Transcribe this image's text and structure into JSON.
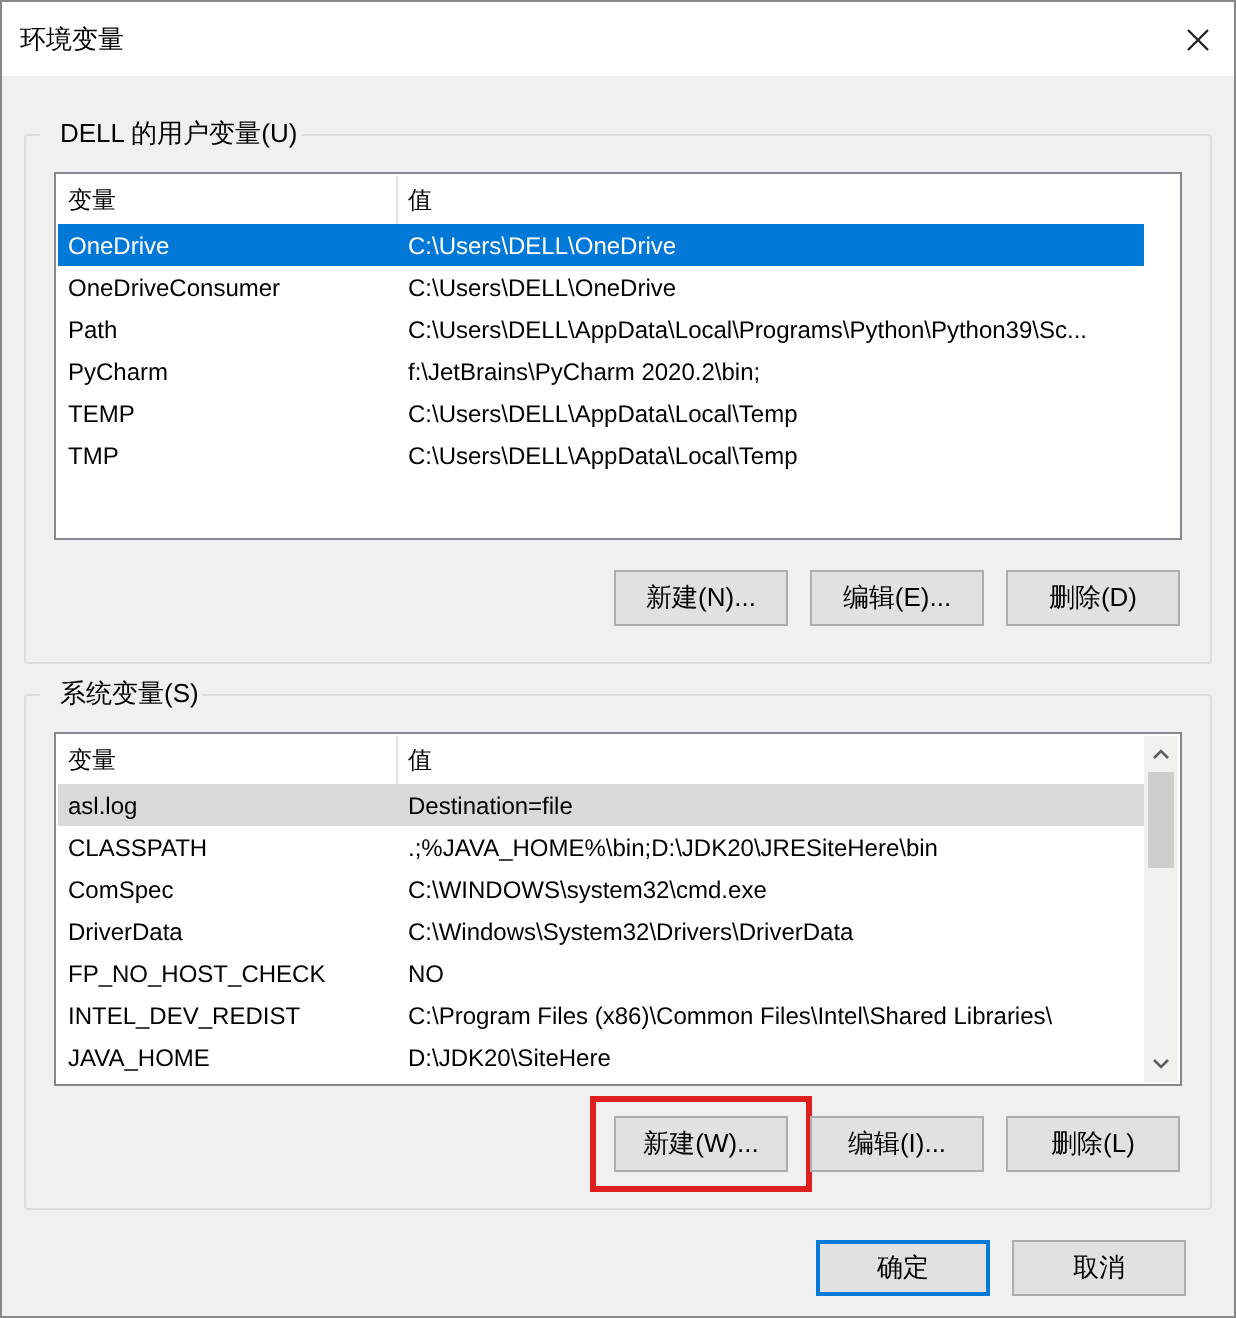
{
  "window": {
    "title": "环境变量"
  },
  "groups": [
    {
      "label": "DELL 的用户变量(U)",
      "focused": true,
      "scrollbar": false,
      "columns": [
        "变量",
        "值"
      ],
      "rows": [
        {
          "name": "OneDrive",
          "value": "C:\\Users\\DELL\\OneDrive",
          "selected": true
        },
        {
          "name": "OneDriveConsumer",
          "value": "C:\\Users\\DELL\\OneDrive",
          "selected": false
        },
        {
          "name": "Path",
          "value": "C:\\Users\\DELL\\AppData\\Local\\Programs\\Python\\Python39\\Sc...",
          "selected": false
        },
        {
          "name": "PyCharm",
          "value": "f:\\JetBrains\\PyCharm 2020.2\\bin;",
          "selected": false
        },
        {
          "name": "TEMP",
          "value": "C:\\Users\\DELL\\AppData\\Local\\Temp",
          "selected": false
        },
        {
          "name": "TMP",
          "value": "C:\\Users\\DELL\\AppData\\Local\\Temp",
          "selected": false
        }
      ],
      "buttons": [
        {
          "label": "新建(N)...",
          "highlighted": false
        },
        {
          "label": "编辑(E)...",
          "highlighted": false
        },
        {
          "label": "删除(D)",
          "highlighted": false
        }
      ]
    },
    {
      "label": "系统变量(S)",
      "focused": false,
      "scrollbar": true,
      "columns": [
        "变量",
        "值"
      ],
      "rows": [
        {
          "name": "asl.log",
          "value": "Destination=file",
          "selected": true
        },
        {
          "name": "CLASSPATH",
          "value": ".;%JAVA_HOME%\\bin;D:\\JDK20\\JRESiteHere\\bin",
          "selected": false
        },
        {
          "name": "ComSpec",
          "value": "C:\\WINDOWS\\system32\\cmd.exe",
          "selected": false
        },
        {
          "name": "DriverData",
          "value": "C:\\Windows\\System32\\Drivers\\DriverData",
          "selected": false
        },
        {
          "name": "FP_NO_HOST_CHECK",
          "value": "NO",
          "selected": false
        },
        {
          "name": "INTEL_DEV_REDIST",
          "value": "C:\\Program Files (x86)\\Common Files\\Intel\\Shared Libraries\\",
          "selected": false
        },
        {
          "name": "JAVA_HOME",
          "value": "D:\\JDK20\\SiteHere",
          "selected": false
        }
      ],
      "buttons": [
        {
          "label": "新建(W)...",
          "highlighted": true
        },
        {
          "label": "编辑(I)...",
          "highlighted": false
        },
        {
          "label": "删除(L)",
          "highlighted": false
        }
      ]
    }
  ],
  "footer_buttons": [
    {
      "label": "确定",
      "default": true
    },
    {
      "label": "取消",
      "default": false
    }
  ]
}
